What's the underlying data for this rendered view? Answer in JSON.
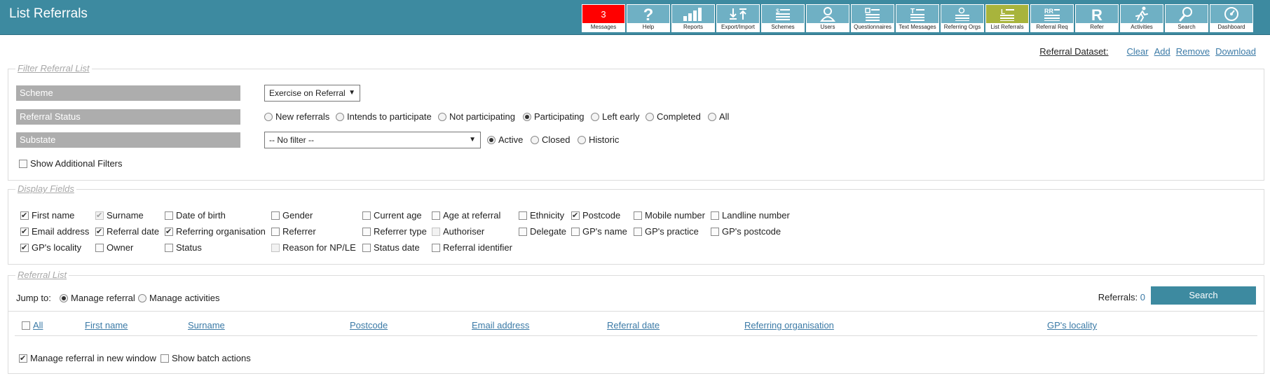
{
  "app": {
    "title": "List Referrals"
  },
  "nav": [
    {
      "label": "Messages",
      "icon": "messages-badge",
      "badge": "3"
    },
    {
      "label": "Help",
      "icon": "question-icon"
    },
    {
      "label": "Reports",
      "icon": "bar-chart-icon"
    },
    {
      "label": "Export/Import",
      "icon": "export-import-icon"
    },
    {
      "label": "Schemes",
      "icon": "schemes-icon"
    },
    {
      "label": "Users",
      "icon": "user-icon"
    },
    {
      "label": "Questionnaires",
      "icon": "questionnaire-icon"
    },
    {
      "label": "Text Messages",
      "icon": "text-message-icon"
    },
    {
      "label": "Referring Orgs",
      "icon": "org-icon"
    },
    {
      "label": "List Referrals",
      "icon": "list-icon"
    },
    {
      "label": "Referral Req",
      "icon": "referral-req-icon"
    },
    {
      "label": "Refer",
      "icon": "refer-icon"
    },
    {
      "label": "Activities",
      "icon": "runner-icon"
    },
    {
      "label": "Search",
      "icon": "search-icon"
    },
    {
      "label": "Dashboard",
      "icon": "dashboard-icon"
    }
  ],
  "top_links": {
    "dataset_label": "Referral Dataset:",
    "clear": "Clear",
    "add": "Add",
    "remove": "Remove",
    "download": "Download"
  },
  "filter": {
    "legend": "Filter Referral List",
    "scheme_label": "Scheme",
    "scheme_value": "Exercise on Referral",
    "status_label": "Referral Status",
    "status_options": [
      {
        "label": "New referrals",
        "selected": false
      },
      {
        "label": "Intends to participate",
        "selected": false
      },
      {
        "label": "Not participating",
        "selected": false
      },
      {
        "label": "Participating",
        "selected": true
      },
      {
        "label": "Left early",
        "selected": false
      },
      {
        "label": "Completed",
        "selected": false
      },
      {
        "label": "All",
        "selected": false
      }
    ],
    "substate_label": "Substate",
    "substate_value": "-- No filter --",
    "substate_options": [
      {
        "label": "Active",
        "selected": true
      },
      {
        "label": "Closed",
        "selected": false
      },
      {
        "label": "Historic",
        "selected": false
      }
    ],
    "additional_filters_label": "Show Additional Filters"
  },
  "display": {
    "legend": "Display Fields",
    "fields": [
      {
        "label": "First name",
        "checked": true
      },
      {
        "label": "Surname",
        "checked": true,
        "disabled": true
      },
      {
        "label": "Date of birth",
        "checked": false
      },
      {
        "label": "Gender",
        "checked": false
      },
      {
        "label": "Current age",
        "checked": false
      },
      {
        "label": "Age at referral",
        "checked": false
      },
      {
        "label": "Ethnicity",
        "checked": false
      },
      {
        "label": "Postcode",
        "checked": true
      },
      {
        "label": "Mobile number",
        "checked": false
      },
      {
        "label": "Landline number",
        "checked": false
      },
      {
        "label": "Email address",
        "checked": true
      },
      {
        "label": "Referral date",
        "checked": true
      },
      {
        "label": "Referring organisation",
        "checked": true
      },
      {
        "label": "Referrer",
        "checked": false
      },
      {
        "label": "Referrer type",
        "checked": false
      },
      {
        "label": "Authoriser",
        "checked": false,
        "disabled": true
      },
      {
        "label": "Delegate",
        "checked": false
      },
      {
        "label": "GP's name",
        "checked": false
      },
      {
        "label": "GP's practice",
        "checked": false
      },
      {
        "label": "GP's postcode",
        "checked": false
      },
      {
        "label": "GP's locality",
        "checked": true
      },
      {
        "label": "Owner",
        "checked": false
      },
      {
        "label": "Status",
        "checked": false
      },
      {
        "label": "Reason for NP/LE",
        "checked": false,
        "disabled": true
      },
      {
        "label": "Status date",
        "checked": false
      },
      {
        "label": "Referral identifier",
        "checked": false
      }
    ]
  },
  "list": {
    "legend": "Referral List",
    "jump_label": "Jump to:",
    "jump_options": [
      {
        "label": "Manage referral",
        "selected": true
      },
      {
        "label": "Manage activities",
        "selected": false
      }
    ],
    "referrals_label": "Referrals:",
    "referrals_count": "0",
    "search_label": "Search",
    "all_label": "All",
    "columns": [
      "First name",
      "Surname",
      "Postcode",
      "Email address",
      "Referral date",
      "Referring organisation",
      "GP's locality"
    ],
    "new_window_label": "Manage referral in new window",
    "batch_label": "Show batch actions"
  },
  "colors": {
    "header_bg": "#3d8aa0",
    "nav_button": "#6fb0c4",
    "nav_alert": "#ff0000",
    "nav_active": "#a8b43c",
    "link": "#3b7aa6",
    "label_bg": "#adadad"
  }
}
